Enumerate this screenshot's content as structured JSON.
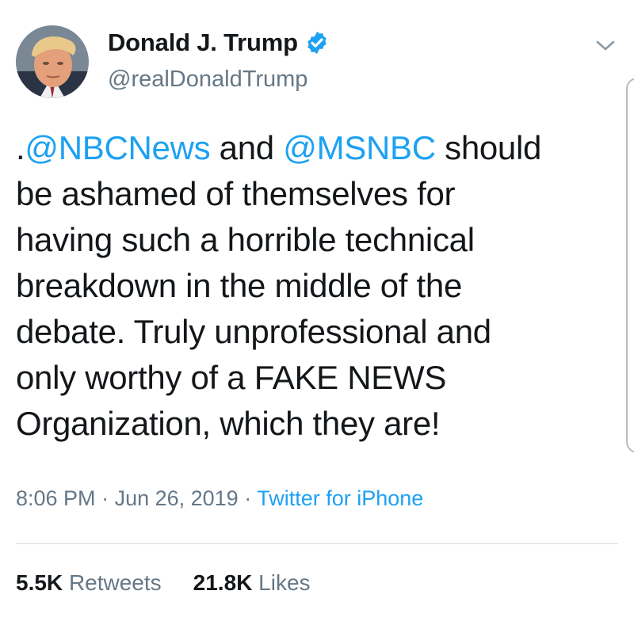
{
  "author": {
    "name": "Donald J. Trump",
    "handle": "@realDonaldTrump",
    "verified_color": "#1da1f2"
  },
  "tweet": {
    "lines": [
      [
        {
          "text": ".",
          "mention": false
        },
        {
          "text": "@NBCNews",
          "mention": true
        },
        {
          "text": " and ",
          "mention": false
        },
        {
          "text": "@MSNBC",
          "mention": true
        },
        {
          "text": " should",
          "mention": false
        }
      ],
      [
        {
          "text": "be ashamed of themselves for",
          "mention": false
        }
      ],
      [
        {
          "text": "having such a horrible technical",
          "mention": false
        }
      ],
      [
        {
          "text": "breakdown in the middle of the",
          "mention": false
        }
      ],
      [
        {
          "text": "debate. Truly unprofessional and",
          "mention": false
        }
      ],
      [
        {
          "text": "only worthy of a FAKE NEWS",
          "mention": false
        }
      ],
      [
        {
          "text": "Organization, which they are!",
          "mention": false
        }
      ]
    ]
  },
  "meta": {
    "time": "8:06 PM",
    "separator": " · ",
    "date": "Jun 26, 2019",
    "source": "Twitter for iPhone"
  },
  "stats": {
    "retweets_count": "5.5K",
    "retweets_label": "Retweets",
    "likes_count": "21.8K",
    "likes_label": "Likes"
  },
  "icons": {
    "verified": "verified-badge-icon",
    "menu": "chevron-down-icon"
  },
  "colors": {
    "link": "#1da1f2",
    "text": "#14171a",
    "muted": "#657786",
    "divider": "#d6dce0"
  }
}
